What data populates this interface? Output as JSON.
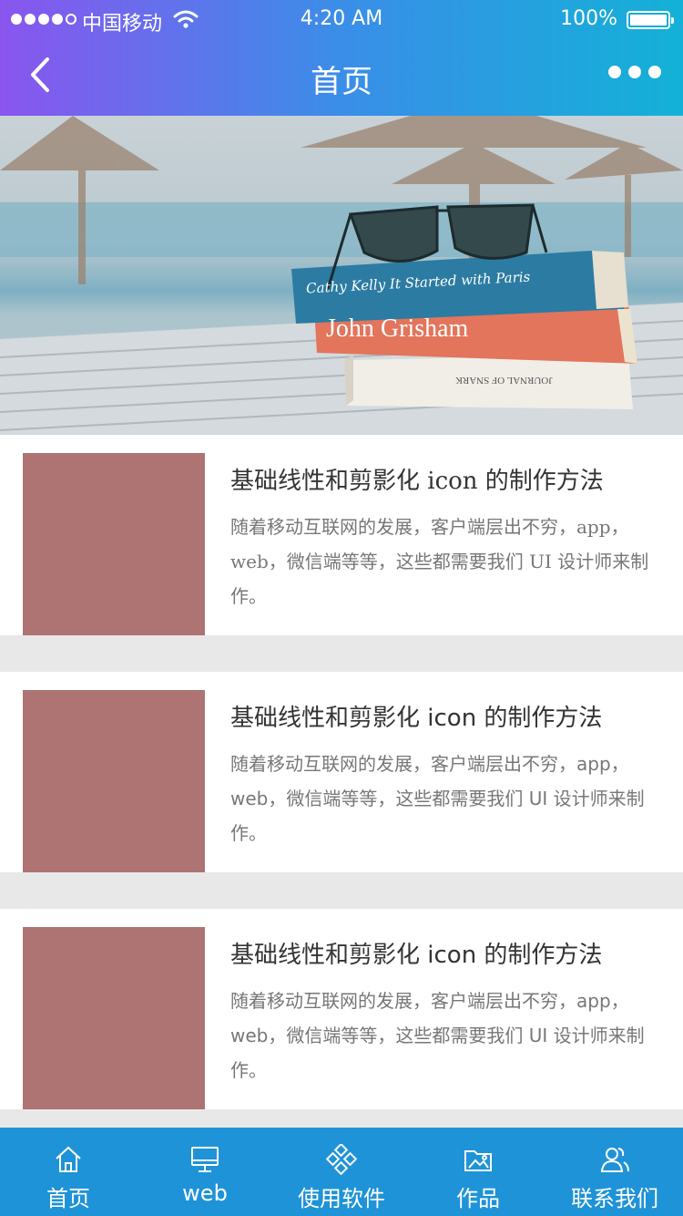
{
  "status_bar": {
    "carrier": "中国移动",
    "time": "4:20 AM",
    "battery": "100%",
    "battery_level": 1.0
  },
  "nav": {
    "title": "首页",
    "back_icon": "chevron-left-icon",
    "more_icon": "more-dots-icon"
  },
  "hero": {
    "book_top": "Cathy Kelly  It Started with Paris",
    "book_middle": "John Grisham",
    "book_bottom": "JOURNAL OF SNARK"
  },
  "articles": [
    {
      "title": "基础线性和剪影化 icon 的制作方法",
      "desc": "随着移动互联网的发展，客户端层出不穷，app，web，微信端等等，这些都需要我们 UI 设计师来制作。"
    },
    {
      "title": "基础线性和剪影化 icon 的制作方法",
      "desc": "随着移动互联网的发展，客户端层出不穷，app，web，微信端等等，这些都需要我们 UI 设计师来制作。"
    },
    {
      "title": "基础线性和剪影化 icon 的制作方法",
      "desc": "随着移动互联网的发展，客户端层出不穷，app，web，微信端等等，这些都需要我们 UI 设计师来制作。"
    }
  ],
  "tabs": [
    {
      "label": "首页",
      "icon": "home-icon"
    },
    {
      "label": "web",
      "icon": "monitor-icon"
    },
    {
      "label": "使用软件",
      "icon": "apps-grid-icon"
    },
    {
      "label": "作品",
      "icon": "folder-image-icon"
    },
    {
      "label": "联系我们",
      "icon": "users-icon"
    }
  ],
  "colors": {
    "header_start": "#8a55ef",
    "header_end": "#13b1d7",
    "tabbar": "#1f93d7",
    "thumbnail": "#ad7473"
  }
}
